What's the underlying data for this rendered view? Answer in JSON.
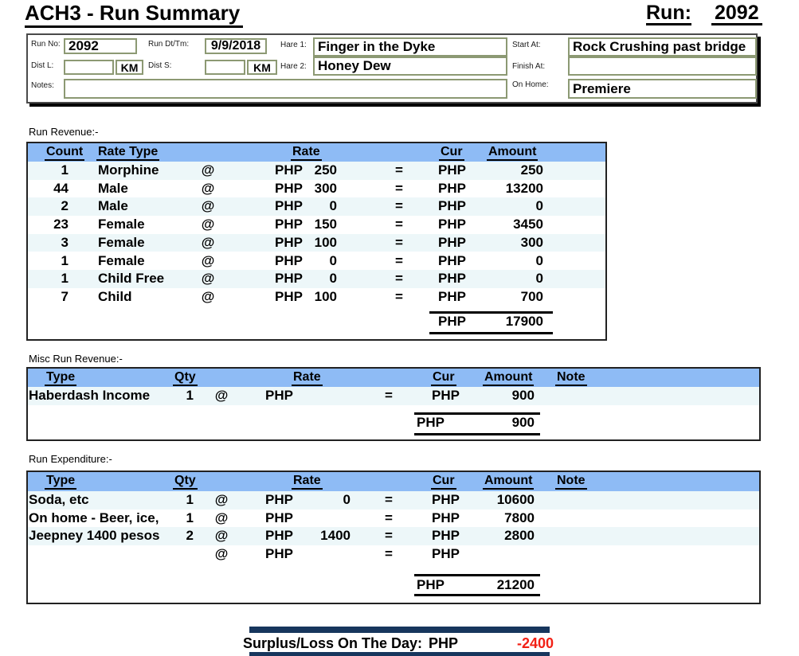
{
  "title": "ACH3 - Run Summary",
  "run": {
    "label": "Run:",
    "number": "2092"
  },
  "symbols": {
    "at": "@",
    "eq": "="
  },
  "header_form": {
    "run_no": {
      "label": "Run No:",
      "value": "2092"
    },
    "run_dttm": {
      "label": "Run Dt/Tm:",
      "value": "9/9/2018"
    },
    "hare1": {
      "label": "Hare 1:",
      "value": "Finger in the Dyke"
    },
    "start_at": {
      "label": "Start At:",
      "value": "Rock Crushing past bridge"
    },
    "dist_l": {
      "label": "Dist L:",
      "value": "",
      "unit": "KM"
    },
    "dist_s": {
      "label": "Dist S:",
      "value": "",
      "unit": "KM"
    },
    "hare2": {
      "label": "Hare 2:",
      "value": "Honey Dew"
    },
    "finish_at": {
      "label": "Finish At:",
      "value": ""
    },
    "notes": {
      "label": "Notes:",
      "value": ""
    },
    "on_home": {
      "label": "On Home:",
      "value": "Premiere"
    }
  },
  "revenue": {
    "section_label": "Run Revenue:-",
    "headers": {
      "count": "Count",
      "rate_type": "Rate Type",
      "rate": "Rate",
      "cur": "Cur",
      "amount": "Amount"
    },
    "rows": [
      {
        "count": "1",
        "type": "Morphine",
        "cur": "PHP",
        "rate": "250",
        "cur2": "PHP",
        "amount": "250"
      },
      {
        "count": "44",
        "type": "Male",
        "cur": "PHP",
        "rate": "300",
        "cur2": "PHP",
        "amount": "13200"
      },
      {
        "count": "2",
        "type": "Male",
        "cur": "PHP",
        "rate": "0",
        "cur2": "PHP",
        "amount": "0"
      },
      {
        "count": "23",
        "type": "Female",
        "cur": "PHP",
        "rate": "150",
        "cur2": "PHP",
        "amount": "3450"
      },
      {
        "count": "3",
        "type": "Female",
        "cur": "PHP",
        "rate": "100",
        "cur2": "PHP",
        "amount": "300"
      },
      {
        "count": "1",
        "type": "Female",
        "cur": "PHP",
        "rate": "0",
        "cur2": "PHP",
        "amount": "0"
      },
      {
        "count": "1",
        "type": "Child Free",
        "cur": "PHP",
        "rate": "0",
        "cur2": "PHP",
        "amount": "0"
      },
      {
        "count": "7",
        "type": "Child",
        "cur": "PHP",
        "rate": "100",
        "cur2": "PHP",
        "amount": "700"
      }
    ],
    "total": {
      "cur": "PHP",
      "amount": "17900"
    }
  },
  "misc": {
    "section_label": "Misc Run Revenue:-",
    "headers": {
      "type": "Type",
      "qty": "Qty",
      "rate": "Rate",
      "cur": "Cur",
      "amount": "Amount",
      "note": "Note"
    },
    "rows": [
      {
        "type": "Haberdash Income",
        "qty": "1",
        "cur": "PHP",
        "rate": "",
        "cur2": "PHP",
        "amount": "900",
        "note": ""
      }
    ],
    "total": {
      "cur": "PHP",
      "amount": "900"
    }
  },
  "expenditure": {
    "section_label": "Run Expenditure:-",
    "headers": {
      "type": "Type",
      "qty": "Qty",
      "rate": "Rate",
      "cur": "Cur",
      "amount": "Amount",
      "note": "Note"
    },
    "rows": [
      {
        "type": "Soda, etc",
        "qty": "1",
        "cur": "PHP",
        "rate": "0",
        "cur2": "PHP",
        "amount": "10600",
        "note": ""
      },
      {
        "type": "On home - Beer, ice,",
        "qty": "1",
        "cur": "PHP",
        "rate": "",
        "cur2": "PHP",
        "amount": "7800",
        "note": ""
      },
      {
        "type": "Jeepney 1400 pesos",
        "qty": "2",
        "cur": "PHP",
        "rate": "1400",
        "cur2": "PHP",
        "amount": "2800",
        "note": ""
      },
      {
        "type": "",
        "qty": "",
        "cur": "PHP",
        "rate": "",
        "cur2": "PHP",
        "amount": "",
        "note": ""
      }
    ],
    "total": {
      "cur": "PHP",
      "amount": "21200"
    }
  },
  "surplus": {
    "label": "Surplus/Loss On The Day:",
    "cur": "PHP",
    "amount": "-2400"
  },
  "colors": {
    "header_blue": "#8ebbf5",
    "row_light": "#edf7f9",
    "bar_navy": "#17365d",
    "negative_red": "#ff2015",
    "box_border_olive": "#8c9973"
  }
}
